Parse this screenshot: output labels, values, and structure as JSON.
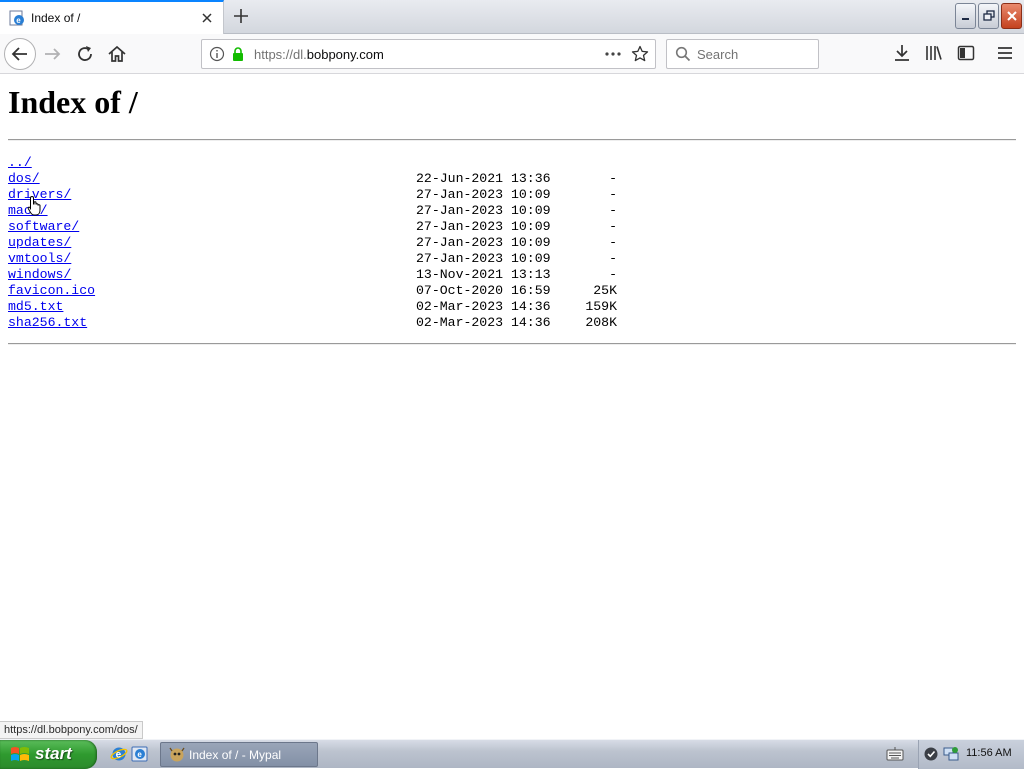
{
  "browser": {
    "tab": {
      "title": "Index of /",
      "favicon": "ie-page-icon"
    },
    "address": {
      "url_prefix": "https://dl.",
      "url_domain": "bobpony.com"
    },
    "search": {
      "placeholder": "Search"
    }
  },
  "page": {
    "heading": "Index of /",
    "entries": [
      {
        "name": "../",
        "date": "",
        "size": ""
      },
      {
        "name": "dos/",
        "date": "22-Jun-2021 13:36",
        "size": "-"
      },
      {
        "name": "drivers/",
        "date": "27-Jan-2023 10:09",
        "size": "-"
      },
      {
        "name": "macs/",
        "date": "27-Jan-2023 10:09",
        "size": "-"
      },
      {
        "name": "software/",
        "date": "27-Jan-2023 10:09",
        "size": "-"
      },
      {
        "name": "updates/",
        "date": "27-Jan-2023 10:09",
        "size": "-"
      },
      {
        "name": "vmtools/",
        "date": "27-Jan-2023 10:09",
        "size": "-"
      },
      {
        "name": "windows/",
        "date": "13-Nov-2021 13:13",
        "size": "-"
      },
      {
        "name": "favicon.ico",
        "date": "07-Oct-2020 16:59",
        "size": "25K"
      },
      {
        "name": "md5.txt",
        "date": "02-Mar-2023 14:36",
        "size": "159K"
      },
      {
        "name": "sha256.txt",
        "date": "02-Mar-2023 14:36",
        "size": "208K"
      }
    ]
  },
  "status": {
    "link_preview": "https://dl.bobpony.com/dos/"
  },
  "taskbar": {
    "start_label": "start",
    "task_label": "Index of / - Mypal",
    "clock": "11:56 AM"
  },
  "colors": {
    "link": "#0000ee",
    "accent": "#0a84ff",
    "start_green": "#2f9a2f"
  }
}
